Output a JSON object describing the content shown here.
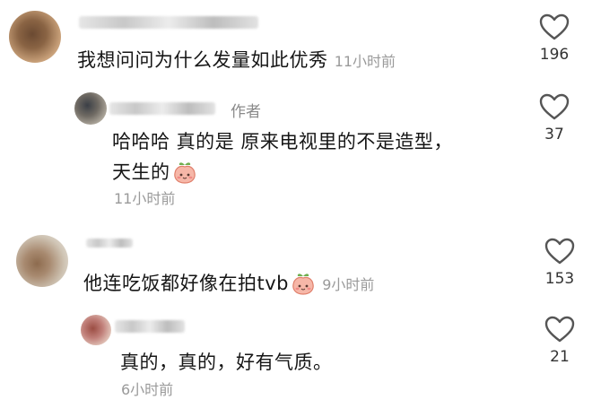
{
  "comments": [
    {
      "text": "我想问问为什么发量如此优秀",
      "time": "11小时前",
      "likes": "196"
    },
    {
      "author_tag": "作者",
      "text_line1": "哈哈哈 真的是 原来电视里的不是造型，",
      "text_line2": "天生的",
      "time": "11小时前",
      "likes": "37"
    },
    {
      "text": "他连吃饭都好像在拍tvb",
      "time": "9小时前",
      "likes": "153"
    },
    {
      "text": "真的，真的，好有气质。",
      "time": "6小时前",
      "likes": "21"
    }
  ],
  "icons": {
    "like": "heart-outline-icon",
    "emoji": "peach-emoji-icon"
  },
  "colors": {
    "text": "#161616",
    "muted": "#9a9a9a",
    "author_tag": "#8a8a8a"
  }
}
